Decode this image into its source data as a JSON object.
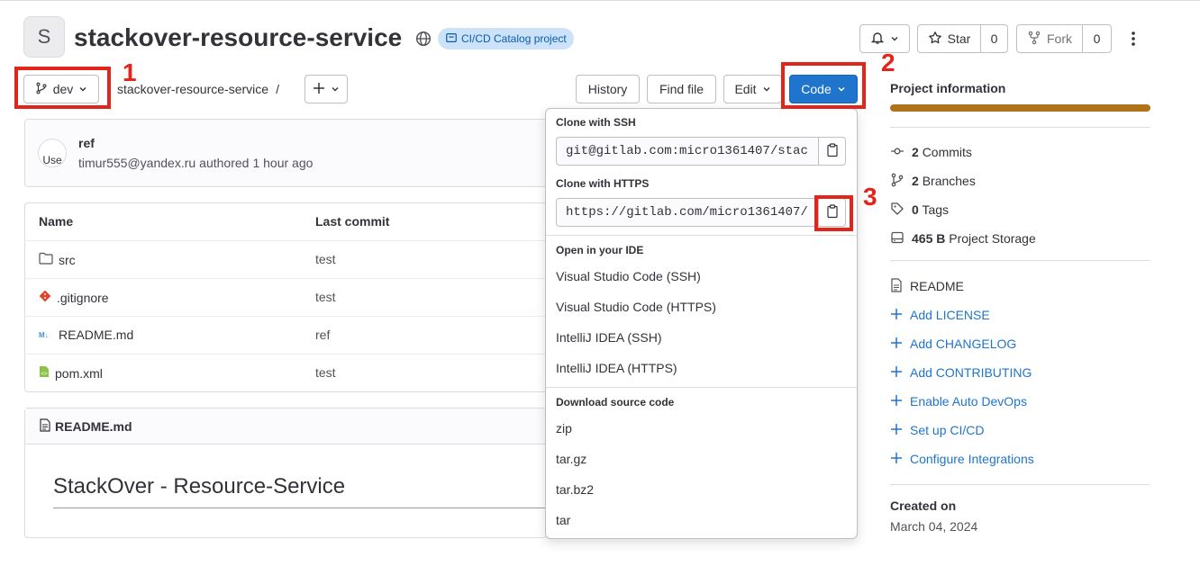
{
  "project": {
    "avatar_letter": "S",
    "name": "stackover-resource-service",
    "badge": "CI/CD Catalog project"
  },
  "header_actions": {
    "star_label": "Star",
    "star_count": "0",
    "fork_label": "Fork",
    "fork_count": "0"
  },
  "toolbar": {
    "branch": "dev",
    "breadcrumb_project": "stackover-resource-service",
    "breadcrumb_sep": "/",
    "history": "History",
    "find_file": "Find file",
    "edit": "Edit",
    "code": "Code"
  },
  "annotations": [
    "1",
    "2",
    "3"
  ],
  "last_commit": {
    "title": "ref",
    "author": "timur555@yandex.ru",
    "authored": "authored",
    "time": "1 hour ago",
    "avatar_alt": "Use"
  },
  "file_table": {
    "headers": [
      "Name",
      "Last commit"
    ],
    "rows": [
      {
        "name": "src",
        "icon": "folder-icon",
        "commit": "test"
      },
      {
        "name": ".gitignore",
        "icon": "git-icon",
        "commit": "test"
      },
      {
        "name": "README.md",
        "icon": "markdown-icon",
        "commit": "ref"
      },
      {
        "name": "pom.xml",
        "icon": "xml-file-icon",
        "commit": "test"
      }
    ]
  },
  "readme": {
    "filename": "README.md",
    "heading": "StackOver - Resource-Service"
  },
  "code_dropdown": {
    "ssh_label": "Clone with SSH",
    "ssh_url": "git@gitlab.com:micro1361407/stac",
    "https_label": "Clone with HTTPS",
    "https_url": "https://gitlab.com/micro1361407/",
    "ide_label": "Open in your IDE",
    "ide_items": [
      "Visual Studio Code (SSH)",
      "Visual Studio Code (HTTPS)",
      "IntelliJ IDEA (SSH)",
      "IntelliJ IDEA (HTTPS)"
    ],
    "download_label": "Download source code",
    "download_items": [
      "zip",
      "tar.gz",
      "tar.bz2",
      "tar"
    ]
  },
  "sidebar": {
    "title": "Project information",
    "stats": [
      {
        "value": "2",
        "label": "Commits",
        "icon": "commit-icon"
      },
      {
        "value": "2",
        "label": "Branches",
        "icon": "branch-icon"
      },
      {
        "value": "0",
        "label": "Tags",
        "icon": "tag-icon"
      },
      {
        "value": "465 B",
        "label": "Project Storage",
        "icon": "storage-icon"
      }
    ],
    "readme": "README",
    "links": [
      "Add LICENSE",
      "Add CHANGELOG",
      "Add CONTRIBUTING",
      "Enable Auto DevOps",
      "Set up CI/CD",
      "Configure Integrations"
    ],
    "created_label": "Created on",
    "created_date": "March 04, 2024"
  },
  "colors": {
    "primary": "#1f75cb",
    "annotation_red": "#e3241b",
    "language_bar": "#b07219"
  }
}
